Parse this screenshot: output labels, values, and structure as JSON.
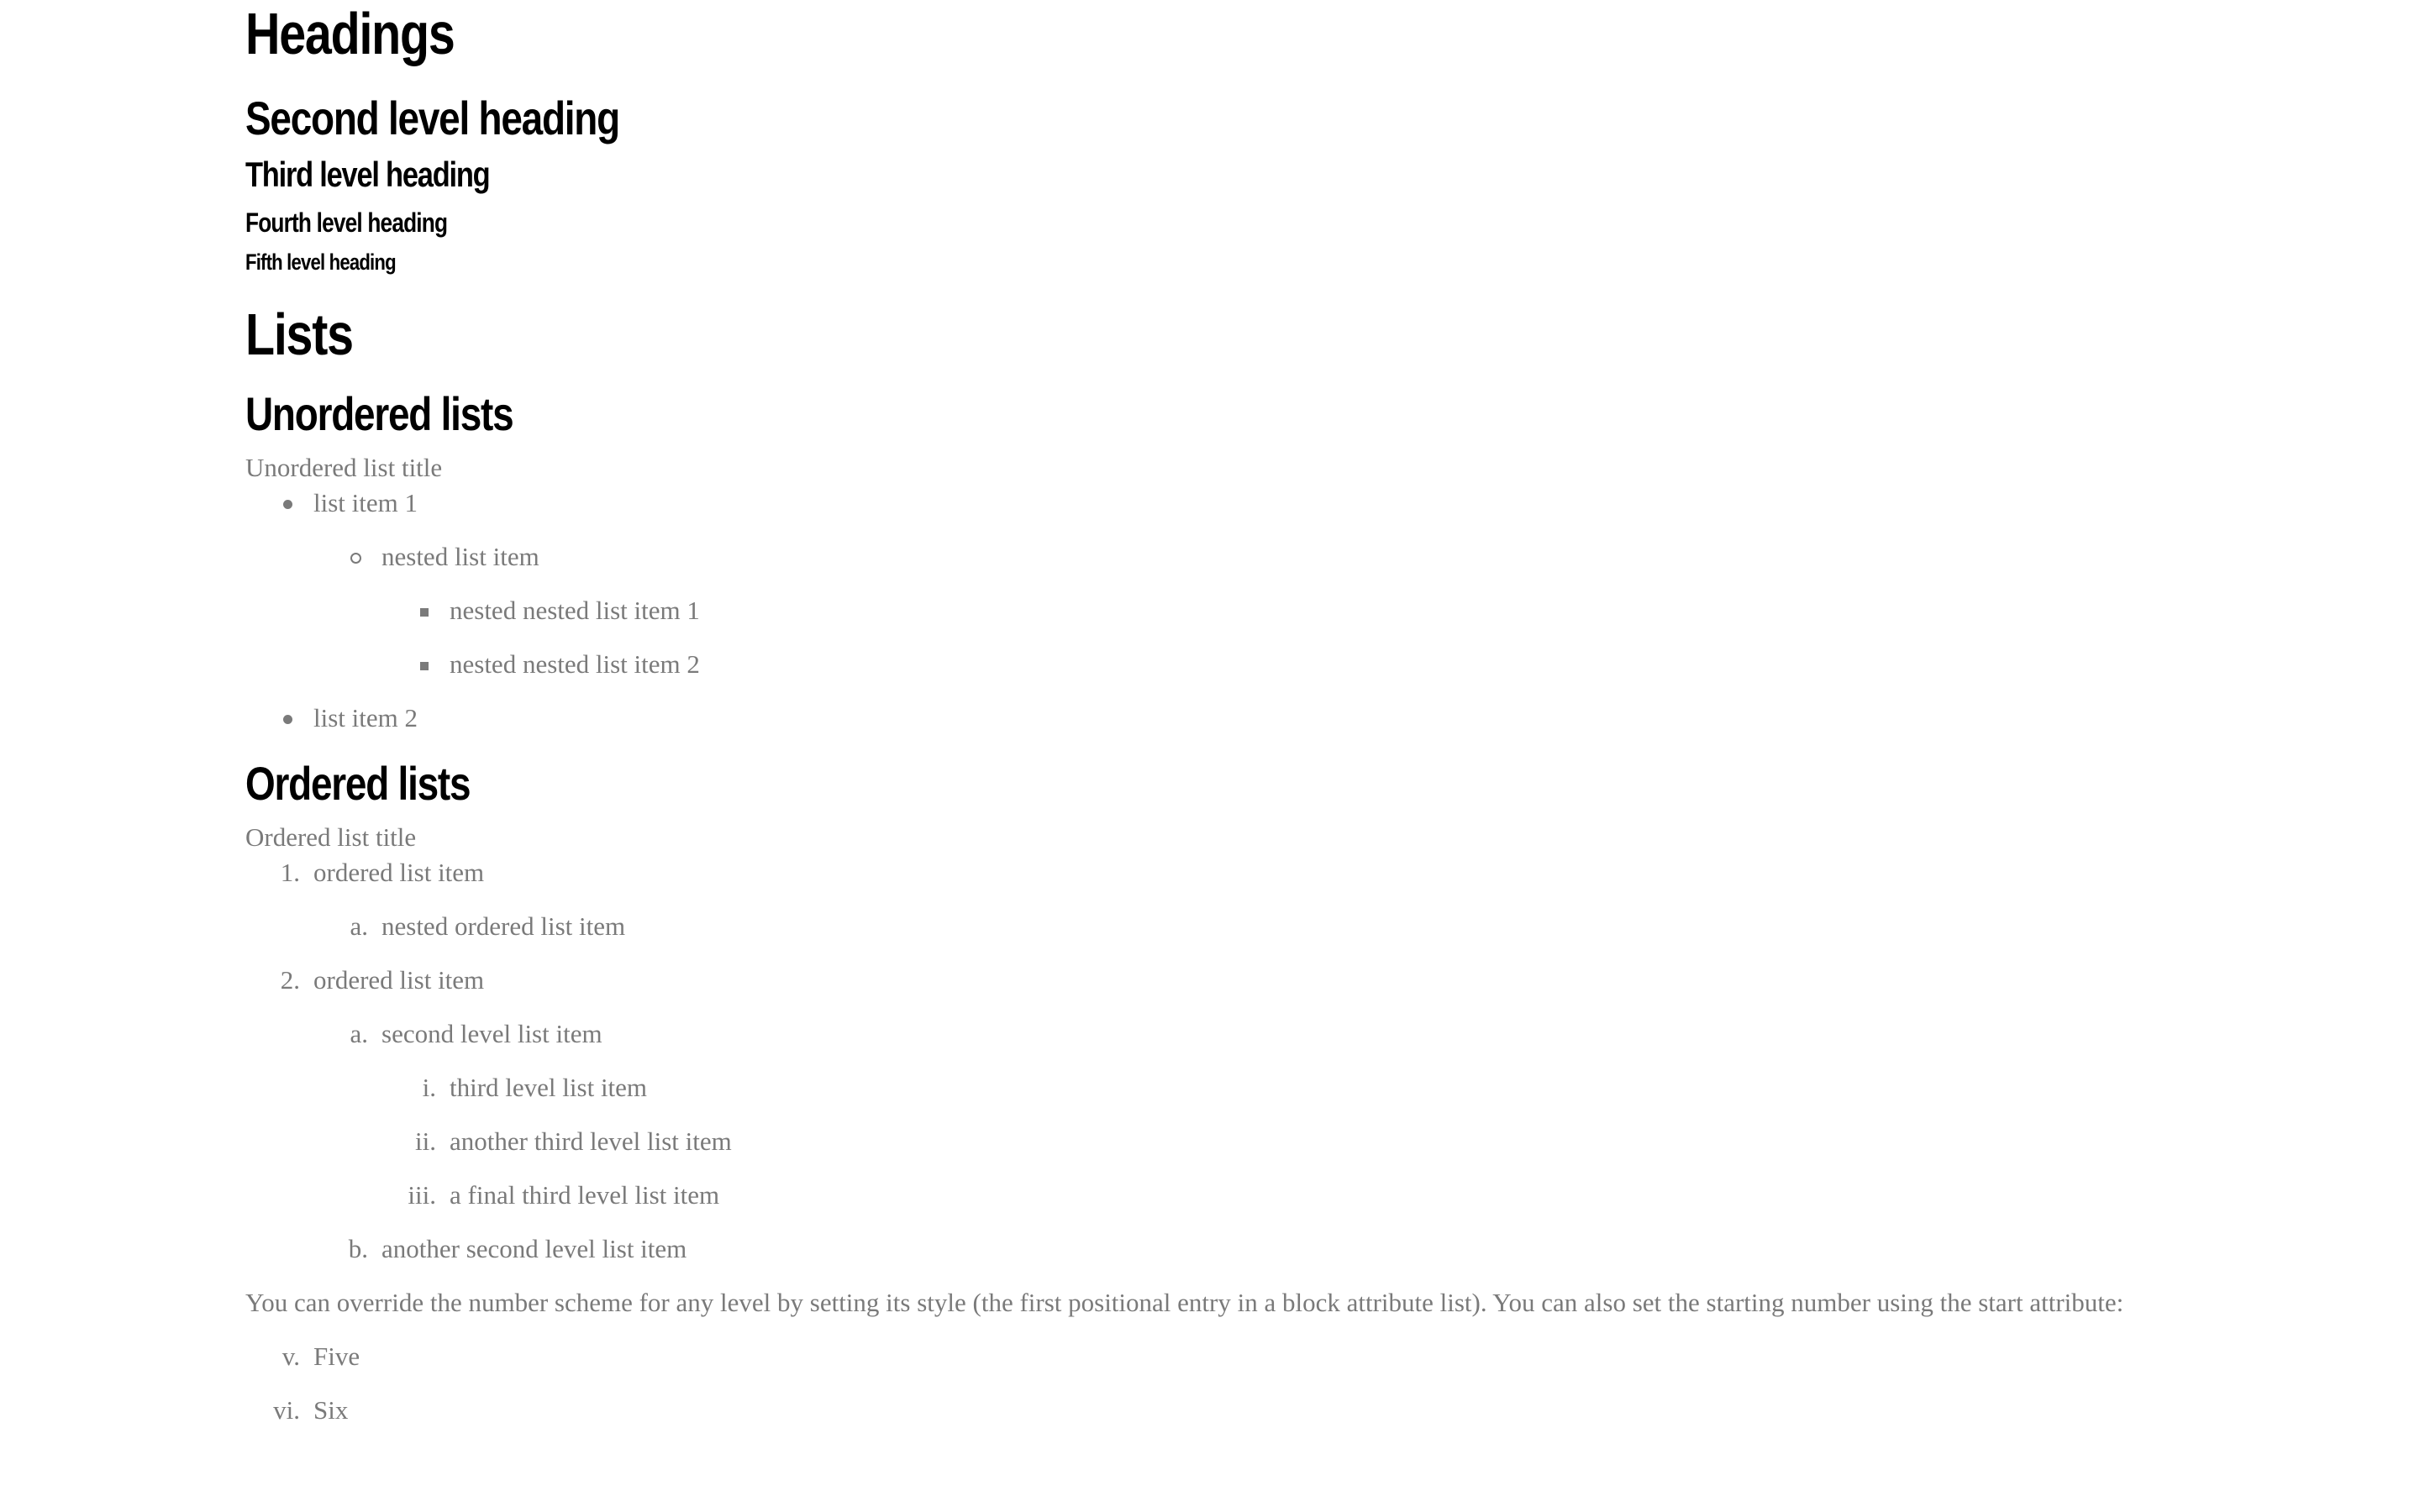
{
  "headings": {
    "h1": "Headings",
    "h2": "Second level heading",
    "h3": "Third level heading",
    "h4": "Fourth level heading",
    "h5": "Fifth level heading"
  },
  "lists": {
    "title": "Lists",
    "unordered": {
      "heading": "Unordered lists",
      "list_title": "Unordered list title",
      "item1": "list item 1",
      "nested": "nested list item",
      "nested_nested_1": "nested nested list item 1",
      "nested_nested_2": "nested nested list item 2",
      "item2": "list item 2"
    },
    "ordered": {
      "heading": "Ordered lists",
      "list_title": "Ordered list title",
      "items": [
        {
          "marker": "1.",
          "text": "ordered list item"
        },
        {
          "marker": "a.",
          "text": "nested ordered list item"
        },
        {
          "marker": "2.",
          "text": "ordered list item"
        },
        {
          "marker": "a.",
          "text": "second level list item"
        },
        {
          "marker": "i.",
          "text": "third level list item"
        },
        {
          "marker": "ii.",
          "text": "another third level list item"
        },
        {
          "marker": "iii.",
          "text": "a final third level list item"
        },
        {
          "marker": "b.",
          "text": "another second level list item"
        }
      ]
    },
    "override_paragraph": "You can override the number scheme for any level by setting its style (the first positional entry in a block attribute list). You can also set the starting number using the start attribute:",
    "roman_items": [
      {
        "marker": "v.",
        "text": "Five"
      },
      {
        "marker": "vi.",
        "text": "Six"
      }
    ]
  }
}
